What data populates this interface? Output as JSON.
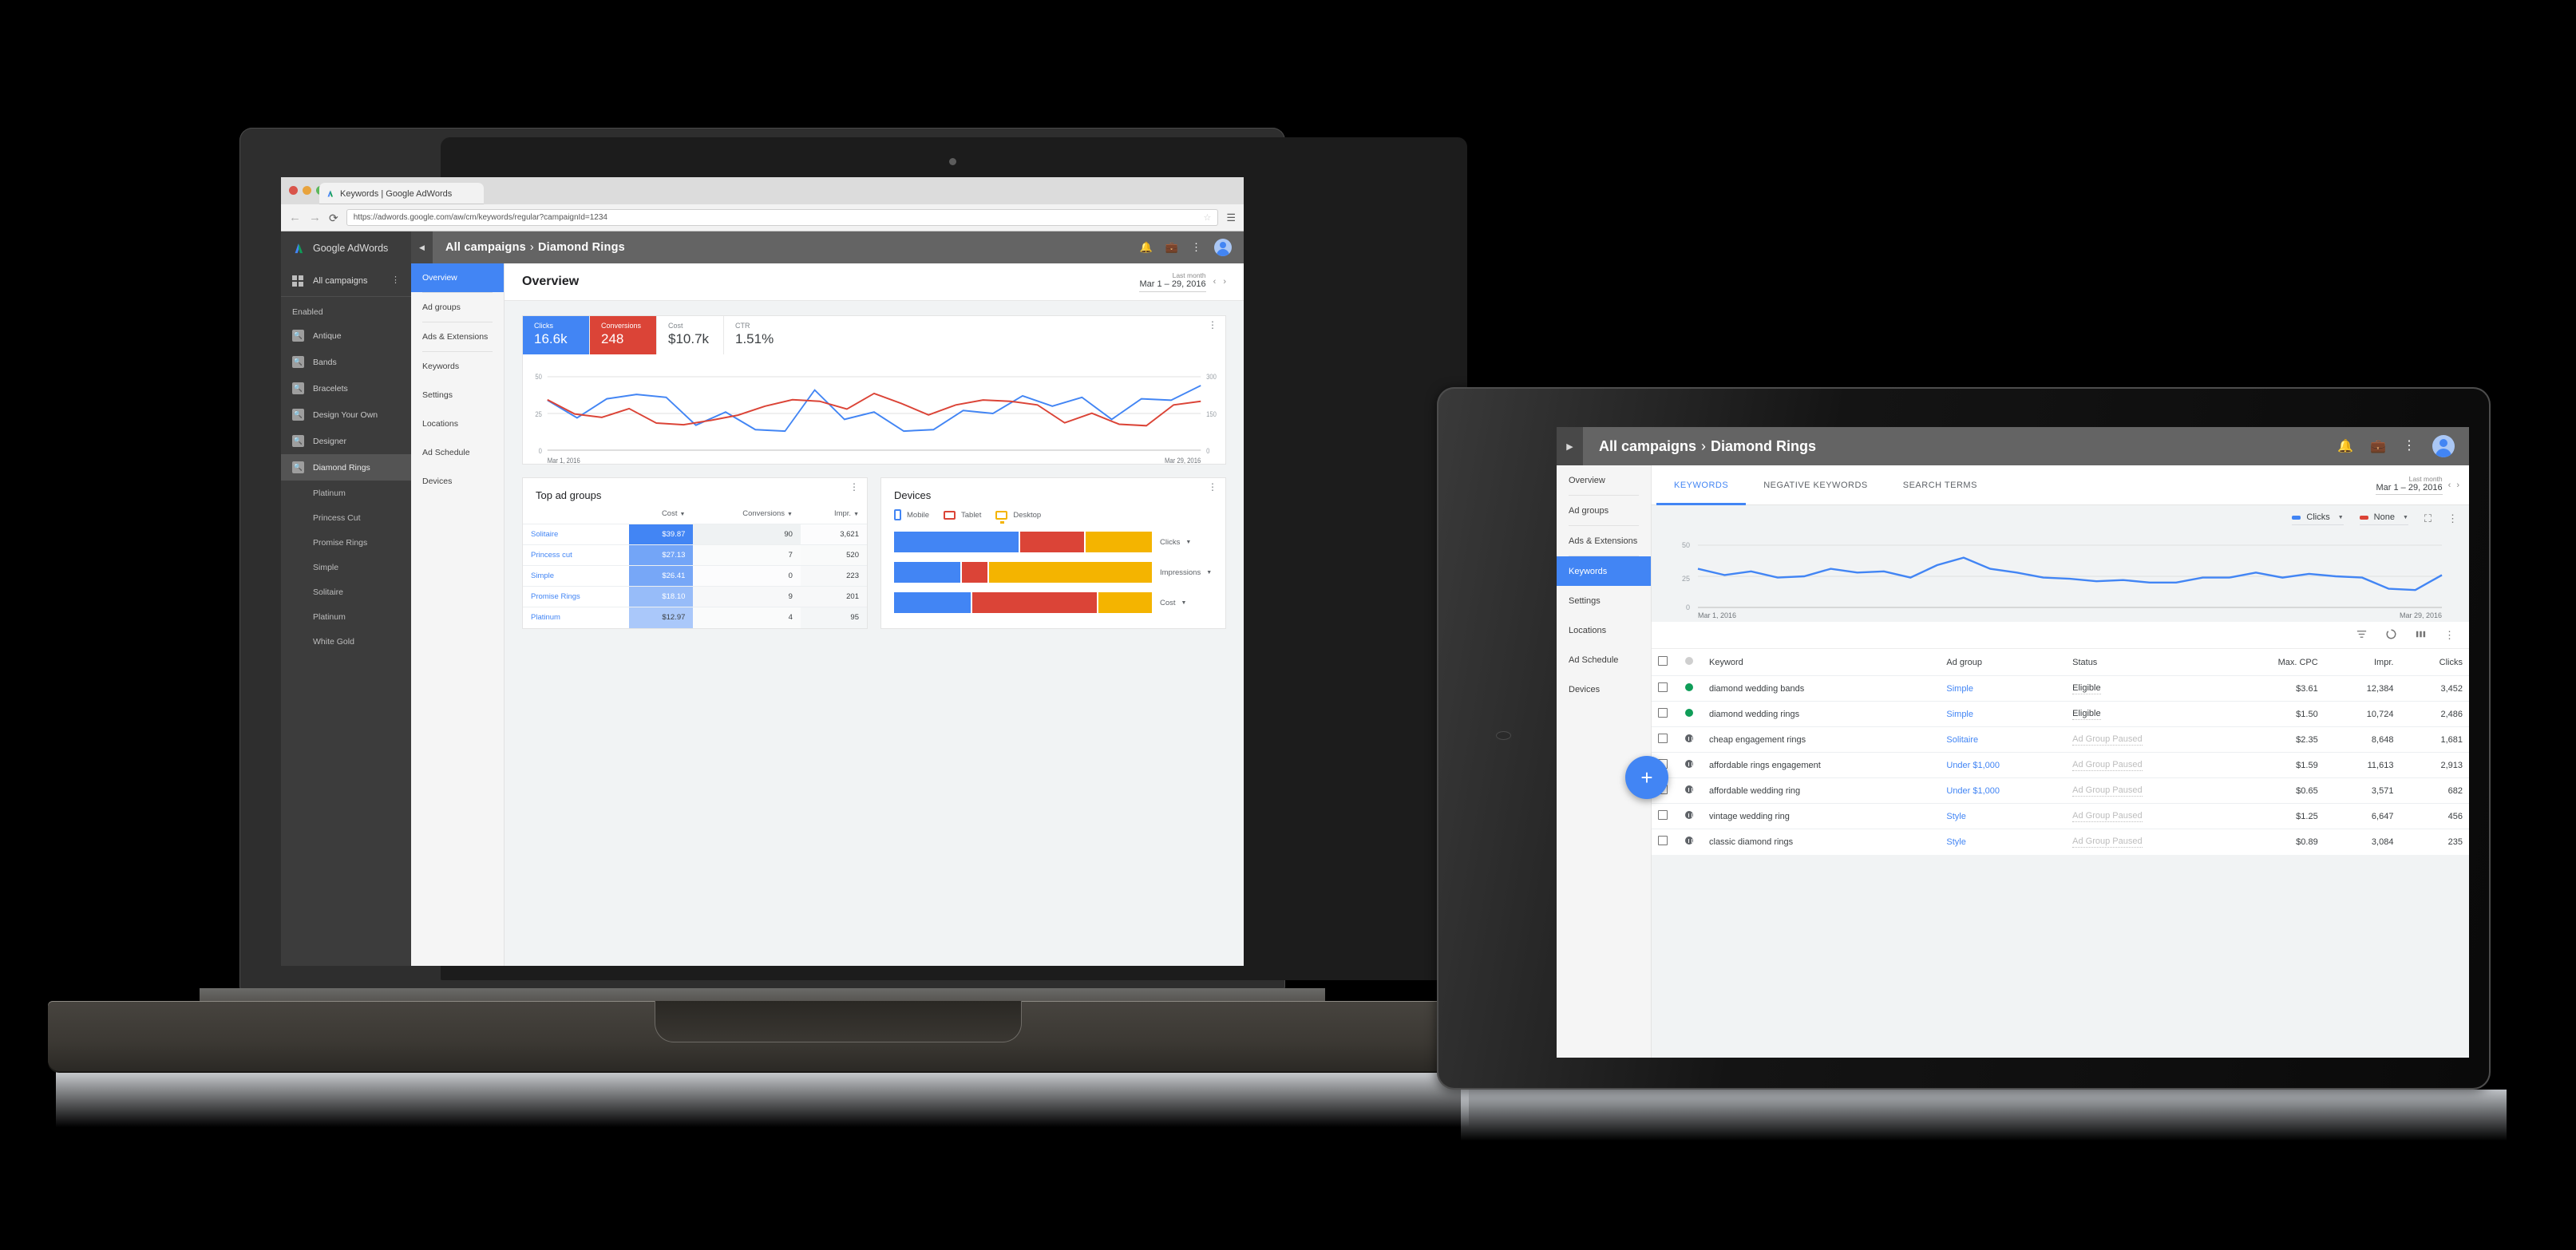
{
  "browser": {
    "tab_title": "Keywords | Google AdWords",
    "url": "https://adwords.google.com/aw/cm/keywords/regular?campaignId=1234",
    "back_icon": "back-arrow-icon",
    "forward_icon": "forward-arrow-icon",
    "reload_icon": "reload-icon",
    "star_icon": "bookmark-star-icon",
    "menu_icon": "hamburger-menu-icon"
  },
  "laptop": {
    "sidebar": {
      "brand": "Google AdWords",
      "all_campaigns": "All campaigns",
      "section_label": "Enabled",
      "campaigns": [
        {
          "label": "Antique",
          "selected": false
        },
        {
          "label": "Bands",
          "selected": false
        },
        {
          "label": "Bracelets",
          "selected": false
        },
        {
          "label": "Design Your Own",
          "selected": false
        },
        {
          "label": "Designer",
          "selected": false
        },
        {
          "label": "Diamond Rings",
          "selected": true
        }
      ],
      "ad_groups": [
        "Platinum",
        "Princess Cut",
        "Promise Rings",
        "Simple",
        "Solitaire",
        "Platinum",
        "White Gold"
      ]
    },
    "topbar": {
      "crumb_root": "All campaigns",
      "crumb_sep": "›",
      "crumb_current": "Diamond Rings",
      "collapse_icon": "collapse-left-icon",
      "bell_icon": "notifications-bell-icon",
      "briefcase_icon": "tools-briefcase-icon",
      "kebab_icon": "more-vert-icon",
      "avatar_icon": "user-avatar"
    },
    "left_nav": [
      {
        "label": "Overview",
        "active": true
      },
      {
        "label": "Ad groups",
        "active": false
      },
      {
        "label": "Ads & Extensions",
        "active": false
      },
      {
        "label": "Keywords",
        "active": false
      },
      {
        "label": "Settings",
        "active": false
      },
      {
        "label": "Locations",
        "active": false
      },
      {
        "label": "Ad Schedule",
        "active": false
      },
      {
        "label": "Devices",
        "active": false
      }
    ],
    "page_title": "Overview",
    "date_range": {
      "label": "Last month",
      "value": "Mar 1 – 29, 2016",
      "prev_icon": "chevron-left-icon",
      "next_icon": "chevron-right-icon"
    },
    "scorecards": [
      {
        "label": "Clicks",
        "value": "16.6k",
        "style": "blue"
      },
      {
        "label": "Conversions",
        "value": "248",
        "style": "red"
      },
      {
        "label": "Cost",
        "value": "$10.7k",
        "style": "plain"
      },
      {
        "label": "CTR",
        "value": "1.51%",
        "style": "plain"
      }
    ],
    "top_ad_groups": {
      "title": "Top ad groups",
      "columns": [
        "",
        "Cost",
        "Conversions",
        "Impr."
      ],
      "rows": [
        {
          "name": "Solitaire",
          "cost": "$39.87",
          "conversions": "90",
          "impr": "3,621"
        },
        {
          "name": "Princess cut",
          "cost": "$27.13",
          "conversions": "7",
          "impr": "520"
        },
        {
          "name": "Simple",
          "cost": "$26.41",
          "conversions": "0",
          "impr": "223"
        },
        {
          "name": "Promise Rings",
          "cost": "$18.10",
          "conversions": "9",
          "impr": "201"
        },
        {
          "name": "Platinum",
          "cost": "$12.97",
          "conversions": "4",
          "impr": "95"
        }
      ]
    },
    "devices": {
      "title": "Devices",
      "legend": [
        "Mobile",
        "Tablet",
        "Desktop"
      ],
      "rows": [
        "Clicks",
        "Impressions",
        "Cost"
      ]
    },
    "colors": {
      "blue": "#4285F4",
      "red": "#DB4437",
      "yellow": "#F4B400",
      "green": "#0F9D58",
      "topbar": "#646464",
      "sidebar": "#3C3C3C"
    }
  },
  "tablet": {
    "topbar": {
      "crumb_root": "All campaigns",
      "crumb_sep": "›",
      "crumb_current": "Diamond Rings",
      "expand_icon": "expand-right-icon",
      "bell_icon": "notifications-bell-icon",
      "briefcase_icon": "tools-briefcase-icon",
      "kebab_icon": "more-vert-icon",
      "avatar_icon": "user-avatar"
    },
    "left_nav": [
      {
        "label": "Overview",
        "active": false
      },
      {
        "label": "Ad groups",
        "active": false
      },
      {
        "label": "Ads & Extensions",
        "active": false
      },
      {
        "label": "Keywords",
        "active": true
      },
      {
        "label": "Settings",
        "active": false
      },
      {
        "label": "Locations",
        "active": false
      },
      {
        "label": "Ad Schedule",
        "active": false
      },
      {
        "label": "Devices",
        "active": false
      }
    ],
    "tabs": [
      {
        "label": "KEYWORDS",
        "active": true
      },
      {
        "label": "NEGATIVE KEYWORDS",
        "active": false
      },
      {
        "label": "SEARCH TERMS",
        "active": false
      }
    ],
    "date_range": {
      "label": "Last month",
      "value": "Mar 1 – 29, 2016",
      "prev_icon": "chevron-left-icon",
      "next_icon": "chevron-right-icon"
    },
    "metric_selectors": [
      {
        "label": "Clicks",
        "color": "#4285F4"
      },
      {
        "label": "None",
        "color": "#DB4437"
      }
    ],
    "expand_icon": "expand-fullscreen-icon",
    "chart_kebab_icon": "more-vert-icon",
    "toolbar_icons": [
      "filter-icon",
      "segment-donut-icon",
      "columns-icon",
      "more-vert-icon"
    ],
    "fab_label": "+",
    "table": {
      "columns": [
        "",
        "",
        "Keyword",
        "Ad group",
        "Status",
        "Max. CPC",
        "Impr.",
        "Clicks"
      ],
      "rows": [
        {
          "status_dot": "green",
          "keyword": "diamond wedding bands",
          "ad_group": "Simple",
          "status": "Eligible",
          "cpc": "$3.61",
          "impr": "12,384",
          "clicks": "3,452"
        },
        {
          "status_dot": "green",
          "keyword": "diamond wedding rings",
          "ad_group": "Simple",
          "status": "Eligible",
          "cpc": "$1.50",
          "impr": "10,724",
          "clicks": "2,486"
        },
        {
          "status_dot": "grey",
          "keyword": "cheap engagement rings",
          "ad_group": "Solitaire",
          "status": "Ad Group Paused",
          "cpc": "$2.35",
          "impr": "8,648",
          "clicks": "1,681"
        },
        {
          "status_dot": "grey",
          "keyword": "affordable rings engagement",
          "ad_group": "Under $1,000",
          "status": "Ad Group Paused",
          "cpc": "$1.59",
          "impr": "11,613",
          "clicks": "2,913"
        },
        {
          "status_dot": "grey",
          "keyword": "affordable wedding ring",
          "ad_group": "Under $1,000",
          "status": "Ad Group Paused",
          "cpc": "$0.65",
          "impr": "3,571",
          "clicks": "682"
        },
        {
          "status_dot": "grey",
          "keyword": "vintage wedding ring",
          "ad_group": "Style",
          "status": "Ad Group Paused",
          "cpc": "$1.25",
          "impr": "6,647",
          "clicks": "456"
        },
        {
          "status_dot": "grey",
          "keyword": "classic diamond rings",
          "ad_group": "Style",
          "status": "Ad Group Paused",
          "cpc": "$0.89",
          "impr": "3,084",
          "clicks": "235"
        }
      ]
    }
  },
  "chart_data": [
    {
      "id": "overview_line",
      "type": "line",
      "title": "Overview performance",
      "xlabel": "",
      "ylabel": "",
      "x_tick_labels": [
        "Mar 1, 2016",
        "Mar 29, 2016"
      ],
      "left_axis": {
        "label": "Clicks",
        "ticks": [
          0,
          25,
          50
        ],
        "ylim": [
          0,
          50
        ]
      },
      "right_axis": {
        "label": "Conversions",
        "ticks": [
          0,
          150,
          300
        ],
        "ylim": [
          0,
          300
        ]
      },
      "grid": true,
      "legend": "none",
      "series": [
        {
          "name": "Clicks",
          "color": "#4285F4",
          "axis": "left",
          "values": [
            34,
            22,
            35,
            38,
            36,
            17,
            26,
            14,
            13,
            41,
            21,
            26,
            13,
            14,
            27,
            25,
            37,
            30,
            36,
            21,
            35,
            34,
            44
          ]
        },
        {
          "name": "Conversions",
          "color": "#DB4437",
          "axis": "right",
          "values": [
            206,
            148,
            134,
            170,
            111,
            104,
            122,
            143,
            180,
            206,
            200,
            168,
            232,
            191,
            144,
            185,
            205,
            200,
            185,
            112,
            151,
            106,
            100,
            185,
            200
          ]
        }
      ]
    },
    {
      "id": "devices_stacked",
      "type": "bar",
      "title": "Devices",
      "orientation": "horizontal",
      "stacked": true,
      "categories": [
        "Clicks",
        "Impressions",
        "Cost"
      ],
      "legend": [
        "Mobile",
        "Tablet",
        "Desktop"
      ],
      "colors": [
        "#4285F4",
        "#DB4437",
        "#F4B400"
      ],
      "series": [
        {
          "name": "Mobile",
          "values": [
            49,
            26,
            30
          ]
        },
        {
          "name": "Tablet",
          "values": [
            25,
            10,
            49
          ]
        },
        {
          "name": "Desktop",
          "values": [
            26,
            64,
            21
          ]
        }
      ],
      "unit": "percent"
    },
    {
      "id": "keywords_line",
      "type": "line",
      "title": "Keywords performance",
      "x_tick_labels": [
        "Mar 1, 2016",
        "Mar 29, 2016"
      ],
      "ylim": [
        0,
        50
      ],
      "yticks": [
        0,
        25,
        50
      ],
      "grid": true,
      "series": [
        {
          "name": "Clicks",
          "color": "#4285F4",
          "values": [
            31,
            26,
            29,
            24,
            25,
            31,
            28,
            29,
            24,
            34,
            40,
            31,
            28,
            24,
            23,
            21,
            22,
            20,
            20,
            24,
            24,
            28,
            24,
            27,
            25,
            24,
            15,
            14,
            26
          ]
        }
      ]
    },
    {
      "id": "top_ad_groups_cost_heat",
      "type": "table",
      "title": "Top ad groups",
      "categories": [
        "Solitaire",
        "Princess cut",
        "Simple",
        "Promise Rings",
        "Platinum"
      ],
      "series": [
        {
          "name": "Cost",
          "values": [
            39.87,
            27.13,
            26.41,
            18.1,
            12.97
          ]
        },
        {
          "name": "Conversions",
          "values": [
            90,
            7,
            0,
            9,
            4
          ]
        },
        {
          "name": "Impr.",
          "values": [
            3621,
            520,
            223,
            201,
            95
          ]
        }
      ]
    }
  ]
}
